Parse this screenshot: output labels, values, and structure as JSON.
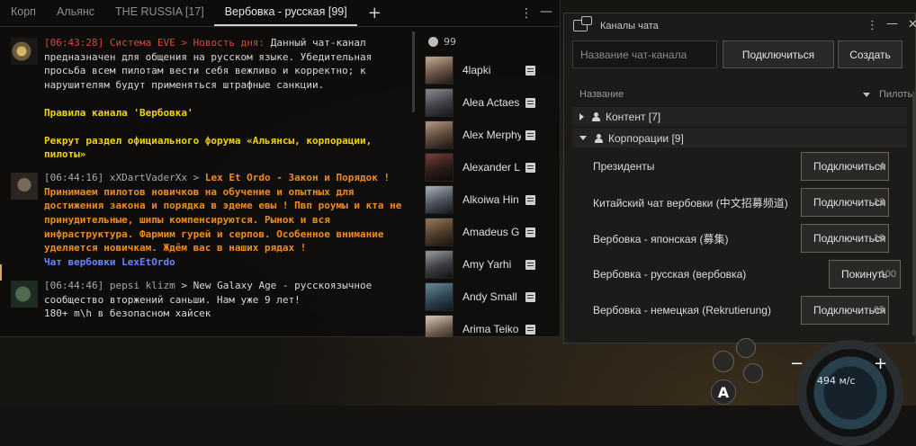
{
  "chat": {
    "tabs": [
      "Корп",
      "Альянс",
      "THE RUSSIA [17]",
      "Вербовка - русская [99]"
    ],
    "active_tab_index": 3,
    "member_count": "99",
    "messages": [
      {
        "time": "[06:43:28]",
        "sender": "Система EVE",
        "subject": "Новость дня:",
        "text": "Данный чат-канал предназначен для общения на русском языке. Убедительная просьба всем пилотам вести себя вежливо и корректно; к нарушителям будут применяться штрафные санкции.",
        "extra1": "Правила канала 'Вербовка'",
        "extra2": "Рекрут раздел официального форума «Альянсы, корпорации, пилоты»"
      },
      {
        "time": "[06:44:16]",
        "sender": "xXDartVaderXx",
        "title": "Lex Et Ordo - Закон и Порядок !",
        "text": "Принимаем пилотов новичков на обучение и опытных для достижения закона и порядка в эдеме евы ! Пвп роумы и кта не принудительные, шипы компенсируются. Рынок и вся инфраструктура. Фармим гурей и серпов. Особенное внимание уделяется новичкам. Ждём вас в наших рядах !",
        "link": "Чат вербовки LexEtOrdo"
      },
      {
        "time": "[06:44:46]",
        "sender": "pepsi klizm",
        "text": "New Galaxy Age - русскоязычное сообщество вторжений саньши. Нам уже 9 лет!",
        "text2": "180+ m\\h в безопасном хайсек"
      }
    ],
    "members": [
      "4lapki",
      "Alea Actaes",
      "Alex Merphy",
      "Alexander L",
      "Alkoiwa Hin",
      "Amadeus G",
      "Amy Yarhi",
      "Andy Small",
      "Arima Teiko"
    ]
  },
  "channels": {
    "title": "Каналы чата",
    "search_placeholder": "Название чат-канала",
    "connect_label": "Подключиться",
    "create_label": "Создать",
    "col_name": "Название",
    "col_pilots": "Пилоты",
    "groups": [
      {
        "label": "Контент [7]",
        "expanded": false
      },
      {
        "label": "Корпорации [9]",
        "expanded": true
      }
    ],
    "rows": [
      {
        "name": "Президенты",
        "button": "Подключиться",
        "count": "4"
      },
      {
        "name": "Китайский чат вербовки (中文招募频道)",
        "button": "Подключиться",
        "count": "12"
      },
      {
        "name": "Вербовка - японская (募集)",
        "button": "Подключиться",
        "count": "10"
      },
      {
        "name": "Вербовка - русская (вербовка)",
        "button": "Покинуть",
        "count": "100"
      },
      {
        "name": "Вербовка - немецкая (Rekrutierung)",
        "button": "Подключиться",
        "count": "65"
      }
    ]
  },
  "hud": {
    "speed": "494 м/с",
    "autopilot_label": "A"
  },
  "colors": {
    "system_red": "#d84a3a",
    "motd_yellow": "#f2d400",
    "recruit_orange": "#f08c1a",
    "link_blue": "#6a83ff"
  }
}
